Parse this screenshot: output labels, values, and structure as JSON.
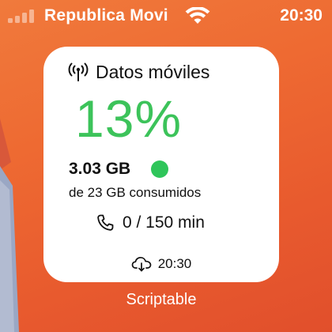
{
  "status_bar": {
    "carrier": "Republica Movi",
    "time": "20:30",
    "signal_bars_active": 0,
    "signal_bars_total": 4,
    "icons": [
      "cellular-signal-icon",
      "wifi-icon"
    ]
  },
  "widget": {
    "title": "Datos móviles",
    "title_icon": "antenna-icon",
    "percent_used": "13%",
    "data_used": "3.03 GB",
    "data_total_text": "de 23 GB consumidos",
    "status_color": "#2fc55a",
    "minutes_icon": "phone-icon",
    "minutes_text": "0 / 150 min",
    "update_icon": "cloud-refresh-icon",
    "update_time": "20:30"
  },
  "app_label": "Scriptable",
  "colors": {
    "accent_green": "#3cc35a",
    "wallpaper_orange": "#ee6a32",
    "widget_background": "#ffffff"
  }
}
